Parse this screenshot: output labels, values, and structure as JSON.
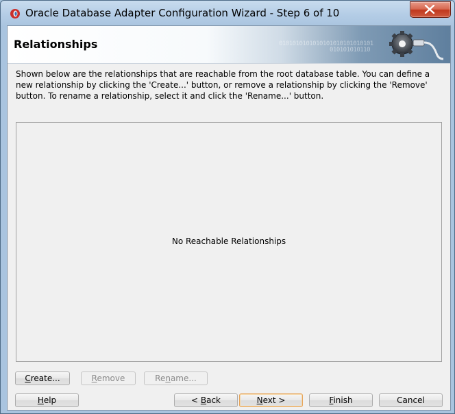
{
  "window": {
    "title": "Oracle Database Adapter Configuration Wizard - Step 6 of 10"
  },
  "banner": {
    "title": "Relationships",
    "binary_line1": "0101010101010101010101010101",
    "binary_line2": "010101010110"
  },
  "description": "Shown below are the relationships that are reachable from the root database table.  You can define a new relationship by clicking the 'Create...' button, or remove a relationship by clicking the 'Remove' button.  To rename a relationship, select it and click the 'Rename...' button.",
  "relationships": {
    "empty_message": "No Reachable Relationships"
  },
  "actions": {
    "create": {
      "mnemonic": "C",
      "rest": "reate..."
    },
    "remove": {
      "mnemonic": "R",
      "rest": "emove"
    },
    "rename": {
      "pre": "Re",
      "mnemonic": "n",
      "rest": "ame..."
    }
  },
  "footer": {
    "help": {
      "mnemonic": "H",
      "rest": "elp"
    },
    "back": {
      "pre": "< ",
      "mnemonic": "B",
      "rest": "ack"
    },
    "next": {
      "mnemonic": "N",
      "rest": "ext >"
    },
    "finish": {
      "mnemonic": "F",
      "rest": "inish"
    },
    "cancel": "Cancel"
  },
  "colors": {
    "default_button_border": "#e6a45a",
    "close_button": "#c0391f"
  }
}
